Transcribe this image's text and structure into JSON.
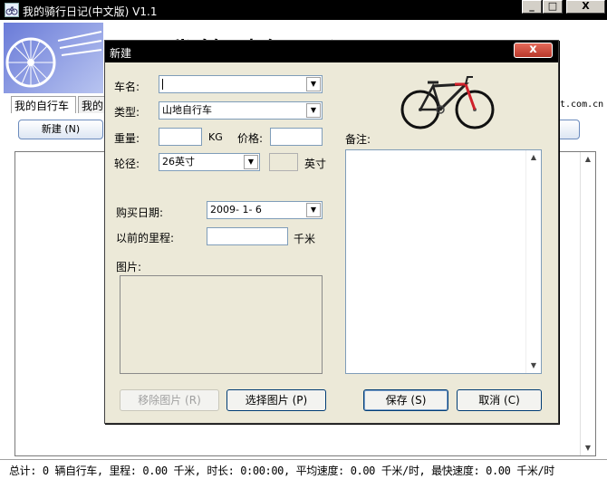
{
  "window": {
    "title": "我的骑行日记(中文版) V1.1",
    "minimize_label": "_",
    "maximize_label": "□",
    "close_label": "X"
  },
  "banner": {
    "title": "我的骑行日记",
    "site_url": "t.com.cn"
  },
  "tabs": [
    {
      "label": "我的自行车"
    },
    {
      "label": "我的"
    }
  ],
  "toolbar": {
    "new_label": "新建 (N)"
  },
  "list": {
    "scroll_up": "▲",
    "scroll_down": "▼"
  },
  "statusbar": {
    "text": "总计: 0 辆自行车, 里程: 0.00 千米, 时长: 0:00:00, 平均速度: 0.00 千米/时, 最快速度: 0.00 千米/时"
  },
  "dialog": {
    "title": "新建",
    "close_label": "x",
    "fields": {
      "name_label": "车名:",
      "name_value": "",
      "type_label": "类型:",
      "type_value": "山地自行车",
      "weight_label": "重量:",
      "weight_value": "",
      "weight_unit": "KG",
      "price_label": "价格:",
      "price_value": "",
      "wheel_label": "轮径:",
      "wheel_value": "26英寸",
      "wheel_custom_value": "",
      "wheel_unit": "英寸",
      "date_label": "购买日期:",
      "date_value": "2009- 1- 6",
      "previous_km_label": "以前的里程:",
      "previous_km_value": "",
      "km_unit": "千米",
      "picture_label": "图片:",
      "remark_label": "备注:"
    },
    "buttons": {
      "remove_picture": "移除图片 (R)",
      "choose_picture": "选择图片 (P)",
      "save": "保存 (S)",
      "cancel": "取消 (C)"
    },
    "dropdown_arrow": "▼"
  }
}
